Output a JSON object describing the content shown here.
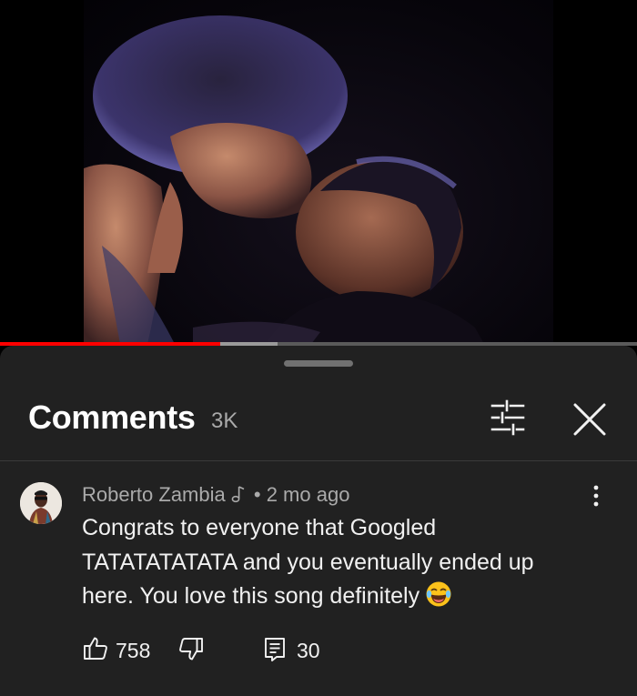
{
  "player": {
    "progress_played_fraction": 0.345,
    "progress_buffered_fraction": 0.435
  },
  "comments_panel": {
    "title": "Comments",
    "count": "3K"
  },
  "comment": {
    "author": "Roberto Zambia",
    "separator": "•",
    "timestamp": "2 mo ago",
    "text": "Congrats to everyone that Googled TATATATATATA and you eventually ended up here. You love this song definitely",
    "emoji": "face-with-tears-of-joy",
    "like_count": "758",
    "reply_count": "30"
  },
  "icons": {
    "filter": "sliders-icon",
    "close": "close-icon",
    "more": "vertical-dots-icon",
    "like": "thumbs-up-icon",
    "dislike": "thumbs-down-icon",
    "reply": "reply-icon",
    "member": "music-note-icon"
  },
  "colors": {
    "background": "#000000",
    "sheet": "#212121",
    "progress_played": "#ff0000",
    "text_primary": "#f1f1f1",
    "text_secondary": "#aaaaaa"
  }
}
